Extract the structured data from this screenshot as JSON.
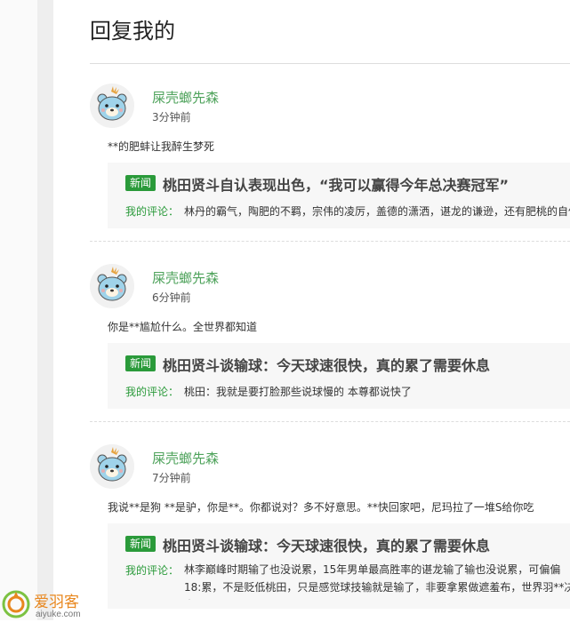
{
  "page": {
    "title": "回复我的"
  },
  "replies": [
    {
      "username": "屎壳螂先森",
      "time": "3分钟前",
      "text": "**的肥蚌让我醉生梦死",
      "quote": {
        "badge": "新闻",
        "title": "桃田贤斗自认表现出色，“我可以赢得今年总决赛冠军”",
        "comment_label": "我的评论：",
        "comment": "林丹的霸气，陶肥的不羁，宗伟的凌厉，盖德的潇洒，谌龙的谦逊，还有肥桃的自信"
      }
    },
    {
      "username": "屎壳螂先森",
      "time": "6分钟前",
      "text": "你是**尴尬什么。全世界都知道",
      "quote": {
        "badge": "新闻",
        "title": "桃田贤斗谈输球：今天球速很快，真的累了需要休息",
        "comment_label": "我的评论：",
        "comment": "桃田：我就是要打脸那些说球慢的 本尊都说快了"
      }
    },
    {
      "username": "屎壳螂先森",
      "time": "7分钟前",
      "text": "我说**是狗 **是驴，你是**。你都说对？多不好意思。**快回家吧，尼玛拉了一堆S给你吃",
      "quote": {
        "badge": "新闻",
        "title": "桃田贤斗谈输球：今天球速很快，真的累了需要休息",
        "comment_label": "我的评论：",
        "comment": "林李巅峰时期输了也没说累，15年男单最高胜率的谌龙输了输也没说累，可偏偏18:累，不是贬低桃田，只是感觉球技输就是输了，非要拿累做遮羞布，世界羽**决赛里上一场公开"
      }
    }
  ],
  "watermark": {
    "name": "爱羽客",
    "domain": "aiyuke.com"
  },
  "colors": {
    "accent_green": "#2a9a3a",
    "username_green": "#4fa35c",
    "watermark_orange": "#e8871e"
  },
  "icons": {
    "avatar": "bear-avatar-icon",
    "logo": "aiyuke-logo-icon"
  }
}
